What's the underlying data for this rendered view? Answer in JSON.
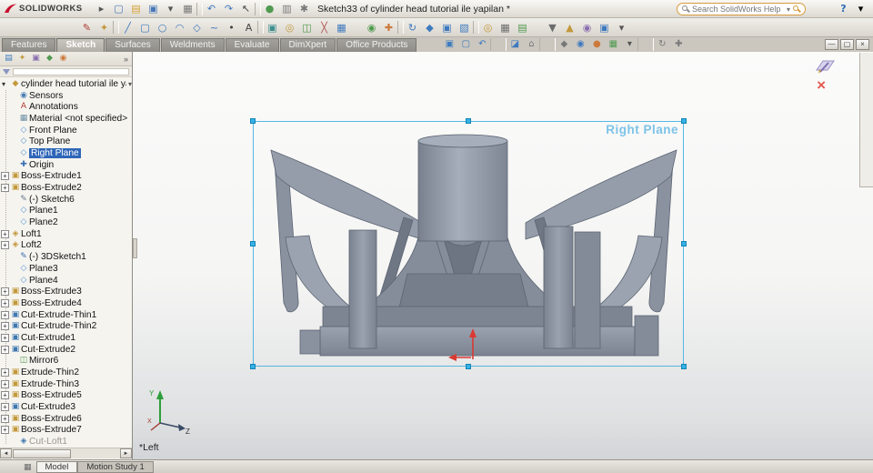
{
  "app": {
    "name": "SOLIDWORKS"
  },
  "titlebar": {
    "document_title": "Sketch33 of cylinder head tutorial ile yapilan *",
    "search_placeholder": "Search SolidWorks Help"
  },
  "glyphs": {
    "caret_down": "▾",
    "plus": "+",
    "help": "?",
    "minimize": "—",
    "restore": "▢",
    "close": "×",
    "cancel_sketch": "×",
    "chevron_right": "»",
    "scroll_left": "◄",
    "scroll_right": "►",
    "status_grid": "▦",
    "part": "◆"
  },
  "toolbar_row1": [
    {
      "name": "menu-pin-icon",
      "glyph": "▸",
      "color": "#555555"
    },
    {
      "name": "new-document-icon",
      "glyph": "▢",
      "color": "#4a78b8"
    },
    {
      "name": "open-document-icon",
      "glyph": "▤",
      "color": "#d9a33c"
    },
    {
      "name": "save-document-icon",
      "glyph": "▣",
      "color": "#4a78b8"
    },
    {
      "name": "save-dropdown-icon",
      "glyph": "▾",
      "color": "#555555"
    },
    {
      "name": "print-document-icon",
      "glyph": "▦",
      "color": "#777777"
    },
    {
      "sep": true
    },
    {
      "name": "undo-icon",
      "glyph": "↶",
      "color": "#3e7abe"
    },
    {
      "name": "redo-icon",
      "glyph": "↷",
      "color": "#3e7abe"
    },
    {
      "name": "select-arrow-icon",
      "glyph": "↖",
      "color": "#444444"
    },
    {
      "sep": true
    },
    {
      "name": "rebuild-icon",
      "glyph": "●",
      "color": "#4f9a4f"
    },
    {
      "name": "file-properties-icon",
      "glyph": "▥",
      "color": "#777777"
    },
    {
      "name": "options-gear-icon",
      "glyph": "✱",
      "color": "#777777"
    }
  ],
  "toolbar_sketch": [
    {
      "name": "sketch-icon",
      "glyph": "✎",
      "color": "#b03a2e"
    },
    {
      "name": "smart-dimension-icon",
      "glyph": "✦",
      "color": "#c2993b"
    },
    {
      "sep": true
    },
    {
      "name": "line-icon",
      "glyph": "╱",
      "color": "#3e7abe"
    },
    {
      "name": "rectangle-icon",
      "glyph": "▢",
      "color": "#3e7abe"
    },
    {
      "name": "circle-icon",
      "glyph": "○",
      "color": "#3e7abe"
    },
    {
      "name": "arc-icon",
      "glyph": "◠",
      "color": "#3e7abe"
    },
    {
      "name": "polygon-icon",
      "glyph": "◇",
      "color": "#3e7abe"
    },
    {
      "name": "spline-icon",
      "glyph": "~",
      "color": "#3e7abe"
    },
    {
      "name": "point-icon",
      "glyph": "•",
      "color": "#444444"
    },
    {
      "name": "text-icon",
      "glyph": "A",
      "color": "#444444"
    },
    {
      "sep": true
    },
    {
      "name": "convert-entities-icon",
      "glyph": "▣",
      "color": "#3f8f8f"
    },
    {
      "name": "offset-entities-icon",
      "glyph": "◎",
      "color": "#c2993b"
    },
    {
      "name": "mirror-entities-icon",
      "glyph": "◫",
      "color": "#4f9a4f"
    },
    {
      "name": "trim-entities-icon",
      "glyph": "╳",
      "color": "#b05050"
    },
    {
      "name": "linear-pattern-icon",
      "glyph": "▦",
      "color": "#3e7abe"
    }
  ],
  "toolbar_mid": [
    {
      "name": "display-relations-icon",
      "glyph": "◉",
      "color": "#4f9a4f"
    },
    {
      "name": "repair-sketch-icon",
      "glyph": "✚",
      "color": "#cc7a3c"
    },
    {
      "sep": true
    },
    {
      "name": "rapid-sketch-icon",
      "glyph": "↻",
      "color": "#3e7abe"
    },
    {
      "name": "move-entities-icon",
      "glyph": "◆",
      "color": "#3e7abe"
    },
    {
      "name": "copy-entities-icon",
      "glyph": "▣",
      "color": "#3e7abe"
    },
    {
      "name": "scale-entities-icon",
      "glyph": "▧",
      "color": "#3e7abe"
    },
    {
      "sep": true
    },
    {
      "name": "quick-snaps-icon",
      "glyph": "◎",
      "color": "#c2993b"
    },
    {
      "name": "grid-settings-icon",
      "glyph": "▦",
      "color": "#6b6b6b"
    },
    {
      "name": "sketch-picture-icon",
      "glyph": "▤",
      "color": "#4f9a4f"
    }
  ],
  "toolbar_right": [
    {
      "name": "selection-filter-icon",
      "glyph": "▼",
      "color": "#6b6b6b"
    },
    {
      "name": "instant3d-icon",
      "glyph": "▲",
      "color": "#c2993b"
    },
    {
      "name": "no-external-refs-icon",
      "glyph": "◉",
      "color": "#8a6fae"
    },
    {
      "name": "numeric-input-icon",
      "glyph": "▣",
      "color": "#3e7abe"
    },
    {
      "name": "toolbar-dropdown-icon",
      "glyph": "▾",
      "color": "#555555"
    }
  ],
  "command_tabs": [
    {
      "label": "Features"
    },
    {
      "label": "Sketch",
      "active": true
    },
    {
      "label": "Surfaces"
    },
    {
      "label": "Weldments"
    },
    {
      "label": "Evaluate"
    },
    {
      "label": "DimXpert"
    },
    {
      "label": "Office Products"
    }
  ],
  "view_toolbar": [
    {
      "name": "zoom-fit-icon",
      "glyph": "▣",
      "color": "#3e7abe"
    },
    {
      "name": "zoom-area-icon",
      "glyph": "▢",
      "color": "#3e7abe"
    },
    {
      "name": "previous-view-icon",
      "glyph": "↶",
      "color": "#3e7abe"
    },
    {
      "sep": true
    },
    {
      "name": "section-view-icon",
      "glyph": "◪",
      "color": "#3e7abe"
    },
    {
      "name": "view-orientation-icon",
      "glyph": "⌂",
      "color": "#777777"
    },
    {
      "sep": true
    },
    {
      "name": "display-style-icon",
      "glyph": "◆",
      "color": "#777777"
    },
    {
      "name": "hide-show-items-icon",
      "glyph": "◉",
      "color": "#3e7abe"
    },
    {
      "name": "edit-appearance-icon",
      "glyph": "●",
      "color": "#cc7a3c"
    },
    {
      "name": "apply-scene-icon",
      "glyph": "▦",
      "color": "#4f9a4f"
    },
    {
      "name": "view-settings-icon",
      "glyph": "▾",
      "color": "#555555"
    },
    {
      "sep": true
    },
    {
      "name": "rotate-view-icon",
      "glyph": "↻",
      "color": "#777777"
    },
    {
      "name": "pan-icon",
      "glyph": "✚",
      "color": "#777777"
    }
  ],
  "window_buttons": [
    {
      "name": "minimize-button",
      "glyph": "—"
    },
    {
      "name": "restore-button",
      "glyph": "▢"
    },
    {
      "name": "close-button",
      "glyph": "×"
    }
  ],
  "manager_tabs": [
    {
      "name": "featuremanager-tab-icon",
      "glyph": "▤",
      "color": "#3e7abe"
    },
    {
      "name": "propertymanager-tab-icon",
      "glyph": "✦",
      "color": "#c2993b"
    },
    {
      "name": "configurationmanager-tab-icon",
      "glyph": "▣",
      "color": "#8a6fae"
    },
    {
      "name": "dimxpertmanager-tab-icon",
      "glyph": "◆",
      "color": "#4f9a4f"
    },
    {
      "name": "displaymanager-tab-icon",
      "glyph": "◉",
      "color": "#cc7a3c"
    }
  ],
  "tree": {
    "root": "cylinder head tutorial ile yapıla",
    "items": [
      {
        "label": "Sensors",
        "icon": "sensors-icon",
        "glyph": "◉",
        "color": "#4a7db5"
      },
      {
        "label": "Annotations",
        "icon": "annotations-icon",
        "glyph": "A",
        "color": "#b03a2e"
      },
      {
        "label": "Material <not specified>",
        "icon": "material-icon",
        "glyph": "▦",
        "color": "#6c8ea4"
      },
      {
        "label": "Front Plane",
        "icon": "plane-icon",
        "glyph": "◇",
        "color": "#4f93d6"
      },
      {
        "label": "Top Plane",
        "icon": "plane-icon",
        "glyph": "◇",
        "color": "#4f93d6"
      },
      {
        "label": "Right Plane",
        "icon": "plane-icon",
        "glyph": "◇",
        "color": "#4f93d6",
        "selected": true
      },
      {
        "label": "Origin",
        "icon": "origin-icon",
        "glyph": "✚",
        "color": "#3b6fb5"
      },
      {
        "label": "Boss-Extrude1",
        "icon": "boss-extrude-icon",
        "glyph": "▣",
        "color": "#c2993b",
        "plus": true
      },
      {
        "label": "Boss-Extrude2",
        "icon": "boss-extrude-icon",
        "glyph": "▣",
        "color": "#c2993b",
        "plus": true
      },
      {
        "label": "(-) Sketch6",
        "icon": "sketch-icon",
        "glyph": "✎",
        "color": "#6b7a8a"
      },
      {
        "label": "Plane1",
        "icon": "plane-icon",
        "glyph": "◇",
        "color": "#4f93d6"
      },
      {
        "label": "Plane2",
        "icon": "plane-icon",
        "glyph": "◇",
        "color": "#4f93d6"
      },
      {
        "label": "Loft1",
        "icon": "loft-icon",
        "glyph": "◈",
        "color": "#c2993b",
        "plus": true
      },
      {
        "label": "Loft2",
        "icon": "loft-icon",
        "glyph": "◈",
        "color": "#c2993b",
        "plus": true
      },
      {
        "label": "(-) 3DSketch1",
        "icon": "3d-sketch-icon",
        "glyph": "✎",
        "color": "#3b6fb5"
      },
      {
        "label": "Plane3",
        "icon": "plane-icon",
        "glyph": "◇",
        "color": "#4f93d6"
      },
      {
        "label": "Plane4",
        "icon": "plane-icon",
        "glyph": "◇",
        "color": "#4f93d6"
      },
      {
        "label": "Boss-Extrude3",
        "icon": "boss-extrude-icon",
        "glyph": "▣",
        "color": "#c2993b",
        "plus": true
      },
      {
        "label": "Boss-Extrude4",
        "icon": "boss-extrude-icon",
        "glyph": "▣",
        "color": "#c2993b",
        "plus": true
      },
      {
        "label": "Cut-Extrude-Thin1",
        "icon": "cut-extrude-icon",
        "glyph": "▣",
        "color": "#3e78b0",
        "plus": true
      },
      {
        "label": "Cut-Extrude-Thin2",
        "icon": "cut-extrude-icon",
        "glyph": "▣",
        "color": "#3e78b0",
        "plus": true
      },
      {
        "label": "Cut-Extrude1",
        "icon": "cut-extrude-icon",
        "glyph": "▣",
        "color": "#3e78b0",
        "plus": true
      },
      {
        "label": "Cut-Extrude2",
        "icon": "cut-extrude-icon",
        "glyph": "▣",
        "color": "#3e78b0",
        "plus": true
      },
      {
        "label": "Mirror6",
        "icon": "mirror-icon",
        "glyph": "◫",
        "color": "#4f9a4f"
      },
      {
        "label": "Extrude-Thin2",
        "icon": "extrude-icon",
        "glyph": "▣",
        "color": "#c2993b",
        "plus": true
      },
      {
        "label": "Extrude-Thin3",
        "icon": "extrude-icon",
        "glyph": "▣",
        "color": "#c2993b",
        "plus": true
      },
      {
        "label": "Boss-Extrude5",
        "icon": "boss-extrude-icon",
        "glyph": "▣",
        "color": "#c2993b",
        "plus": true
      },
      {
        "label": "Cut-Extrude3",
        "icon": "cut-extrude-icon",
        "glyph": "▣",
        "color": "#3e78b0",
        "plus": true
      },
      {
        "label": "Boss-Extrude6",
        "icon": "boss-extrude-icon",
        "glyph": "▣",
        "color": "#c2993b",
        "plus": true
      },
      {
        "label": "Boss-Extrude7",
        "icon": "boss-extrude-icon",
        "glyph": "▣",
        "color": "#c2993b",
        "plus": true
      },
      {
        "label": "Cut-Loft1",
        "icon": "cut-loft-icon",
        "glyph": "◈",
        "color": "#3e78b0",
        "dim": true
      }
    ]
  },
  "viewport": {
    "selection_label": "Right Plane",
    "view_label": "*Left",
    "triad": {
      "x": "X",
      "y": "Y",
      "z": "Z"
    }
  },
  "taskpane": [
    {
      "name": "taskpane-resources-icon",
      "glyph": "⌂",
      "color": "#3e7abe"
    },
    {
      "name": "taskpane-design-library-icon",
      "glyph": "▤",
      "color": "#c2993b"
    },
    {
      "name": "taskpane-file-explorer-icon",
      "glyph": "▣",
      "color": "#d9a33c"
    },
    {
      "name": "taskpane-view-palette-icon",
      "glyph": "▦",
      "color": "#4f9a4f"
    },
    {
      "name": "taskpane-appearances-icon",
      "glyph": "●",
      "color": "#3f8fc4"
    },
    {
      "name": "taskpane-scenes-icon",
      "glyph": "◉",
      "color": "#8a6fae"
    },
    {
      "name": "taskpane-custom-properties-icon",
      "glyph": "▥",
      "color": "#6b6b6b"
    }
  ],
  "statusbar": {
    "tabs": [
      {
        "label": "Model",
        "active": true
      },
      {
        "label": "Motion Study 1"
      }
    ]
  }
}
